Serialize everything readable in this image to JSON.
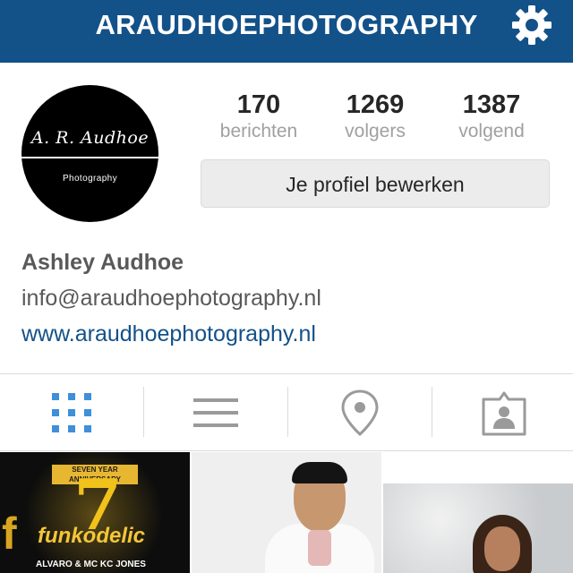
{
  "topbar": {
    "title": "ARAUDHOEPHOTOGRAPHY",
    "settings_icon": "gear-icon",
    "background_color": "#135189"
  },
  "avatar": {
    "script_text": "A. R. Audhoe",
    "subtitle": "Photography"
  },
  "stats": [
    {
      "value": "170",
      "label": "berichten"
    },
    {
      "value": "1269",
      "label": "volgers"
    },
    {
      "value": "1387",
      "label": "volgend"
    }
  ],
  "edit_profile_label": "Je profiel bewerken",
  "profile": {
    "name": "Ashley Audhoe",
    "email": "info@araudhoephotography.nl",
    "website": "www.araudhoephotography.nl",
    "link_color": "#135189"
  },
  "tabs": [
    {
      "icon": "grid-icon",
      "active": true,
      "active_color": "#3f8fd9"
    },
    {
      "icon": "list-icon",
      "active": false
    },
    {
      "icon": "location-pin-icon",
      "active": false
    },
    {
      "icon": "tagged-person-icon",
      "active": false
    }
  ],
  "grid": {
    "post1": {
      "top_text": "SEVEN YEAR ANNIVERSARY",
      "number": "7",
      "brand": "funkodelic",
      "acts": "ALVARO & MC KC JONES"
    }
  }
}
